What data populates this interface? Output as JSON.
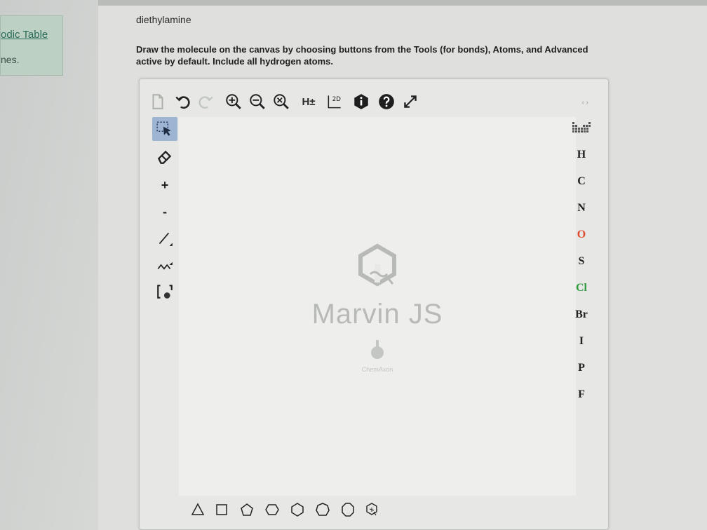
{
  "sidebar": {
    "link_text": "odic Table",
    "text": "nes."
  },
  "question": {
    "molecule_name": "diethylamine",
    "instruction_line1": "Draw the molecule on the canvas by choosing buttons from the Tools (for bonds), Atoms, and Advanced",
    "instruction_line2": "active by default. Include all hydrogen atoms."
  },
  "editor": {
    "top_toolbar": [
      {
        "name": "new-document-icon"
      },
      {
        "name": "undo-icon"
      },
      {
        "name": "redo-icon"
      },
      {
        "name": "zoom-in-icon"
      },
      {
        "name": "zoom-out-icon"
      },
      {
        "name": "zoom-fit-icon"
      },
      {
        "name": "hydrogens-toggle",
        "label": "H±"
      },
      {
        "name": "clean-2d-icon",
        "label": "2D"
      },
      {
        "name": "info-icon"
      },
      {
        "name": "help-icon"
      },
      {
        "name": "fullscreen-icon"
      }
    ],
    "nav_arrows": "‹ ›",
    "left_toolbar": [
      {
        "name": "select-tool-icon",
        "active": true
      },
      {
        "name": "eraser-icon"
      },
      {
        "name": "charge-plus-button",
        "label": "+"
      },
      {
        "name": "charge-minus-button",
        "label": "-"
      },
      {
        "name": "single-bond-icon"
      },
      {
        "name": "chain-icon"
      },
      {
        "name": "bracket-icon"
      }
    ],
    "watermark": {
      "title": "Marvin JS",
      "company": "ChemAxon"
    },
    "atoms": [
      {
        "symbol": "H",
        "color": "#222222"
      },
      {
        "symbol": "C",
        "color": "#222222"
      },
      {
        "symbol": "N",
        "color": "#222222"
      },
      {
        "symbol": "O",
        "color": "#e0482a"
      },
      {
        "symbol": "S",
        "color": "#222222"
      },
      {
        "symbol": "Cl",
        "color": "#2f9b3d"
      },
      {
        "symbol": "Br",
        "color": "#222222"
      },
      {
        "symbol": "I",
        "color": "#222222"
      },
      {
        "symbol": "P",
        "color": "#222222"
      },
      {
        "symbol": "F",
        "color": "#222222"
      }
    ],
    "shapes": [
      "triangle",
      "square",
      "pentagon",
      "hexagon",
      "hexagon-alt",
      "heptagon",
      "octagon",
      "benzene"
    ]
  },
  "colors": {
    "active_tool_bg": "#9db4d3",
    "link": "#2a6b5a",
    "oxygen": "#e0482a",
    "chlorine": "#2f9b3d"
  }
}
